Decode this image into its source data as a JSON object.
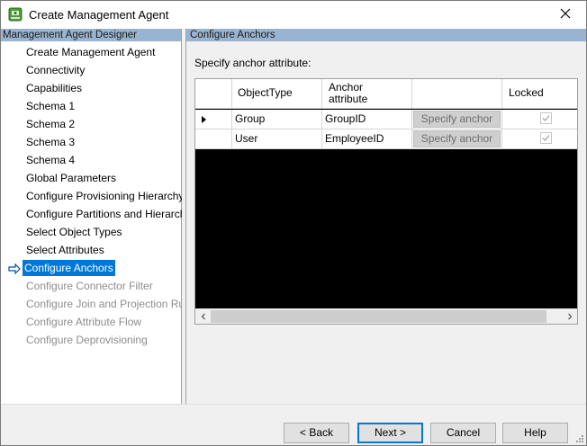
{
  "window": {
    "title": "Create Management Agent",
    "icon": "management-agent-app-icon",
    "close_icon": "close-icon"
  },
  "left_panel": {
    "header": "Management Agent Designer",
    "items": [
      {
        "label": "Create Management Agent",
        "state": "normal"
      },
      {
        "label": "Connectivity",
        "state": "normal"
      },
      {
        "label": "Capabilities",
        "state": "normal"
      },
      {
        "label": "Schema 1",
        "state": "normal"
      },
      {
        "label": "Schema 2",
        "state": "normal"
      },
      {
        "label": "Schema 3",
        "state": "normal"
      },
      {
        "label": "Schema 4",
        "state": "normal"
      },
      {
        "label": "Global Parameters",
        "state": "normal"
      },
      {
        "label": "Configure Provisioning Hierarchy",
        "state": "normal"
      },
      {
        "label": "Configure Partitions and Hierarchies",
        "state": "normal"
      },
      {
        "label": "Select Object Types",
        "state": "normal"
      },
      {
        "label": "Select Attributes",
        "state": "normal"
      },
      {
        "label": "Configure Anchors",
        "state": "selected"
      },
      {
        "label": "Configure Connector Filter",
        "state": "disabled"
      },
      {
        "label": "Configure Join and Projection Rules",
        "state": "disabled"
      },
      {
        "label": "Configure Attribute Flow",
        "state": "disabled"
      },
      {
        "label": "Configure Deprovisioning",
        "state": "disabled"
      }
    ],
    "current_marker_icon": "arrow-right-icon"
  },
  "right_panel": {
    "header": "Configure Anchors",
    "prompt": "Specify anchor attribute:",
    "grid": {
      "columns": {
        "object_type": "ObjectType",
        "anchor_line1": "Anchor",
        "anchor_line2": "attribute",
        "button": "",
        "locked": "Locked"
      },
      "rows": [
        {
          "object_type": "Group",
          "anchor": "GroupID",
          "button_label": "Specify anchor",
          "locked": true,
          "current": true
        },
        {
          "object_type": "User",
          "anchor": "EmployeeID",
          "button_label": "Specify anchor",
          "locked": true,
          "current": false
        }
      ]
    }
  },
  "buttons": {
    "back": "< Back",
    "next": "Next >",
    "cancel": "Cancel",
    "help": "Help"
  },
  "colors": {
    "selection": "#0078d7",
    "panel_header": "#99b4d1",
    "disabled_text": "#8d8d8d"
  }
}
